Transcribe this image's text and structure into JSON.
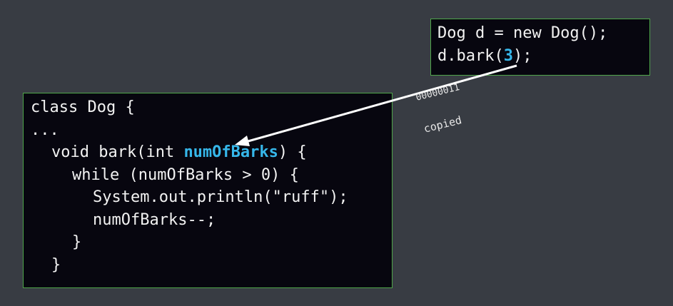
{
  "caller_code": {
    "line1": "Dog d = new Dog();",
    "line2_prefix": "d.bark(",
    "line2_arg": "3",
    "line2_suffix": ");"
  },
  "class_code": {
    "line1": "class Dog {",
    "line2": "...",
    "line3_prefix": "void bark(int ",
    "line3_param": "numOfBarks",
    "line3_suffix": ") {",
    "line4": "while (numOfBarks > 0) {",
    "line5": "System.out.println(\"ruff\");",
    "line6": "numOfBarks--;",
    "line7": "}",
    "line8": "}"
  },
  "annotations": {
    "binary": "00000011",
    "copied": "copied"
  },
  "colors": {
    "background": "#383c43",
    "box_fill": "#07060f",
    "box_border": "#4fa64a",
    "highlight": "#36b7ea",
    "arrow": "#ffffff"
  }
}
